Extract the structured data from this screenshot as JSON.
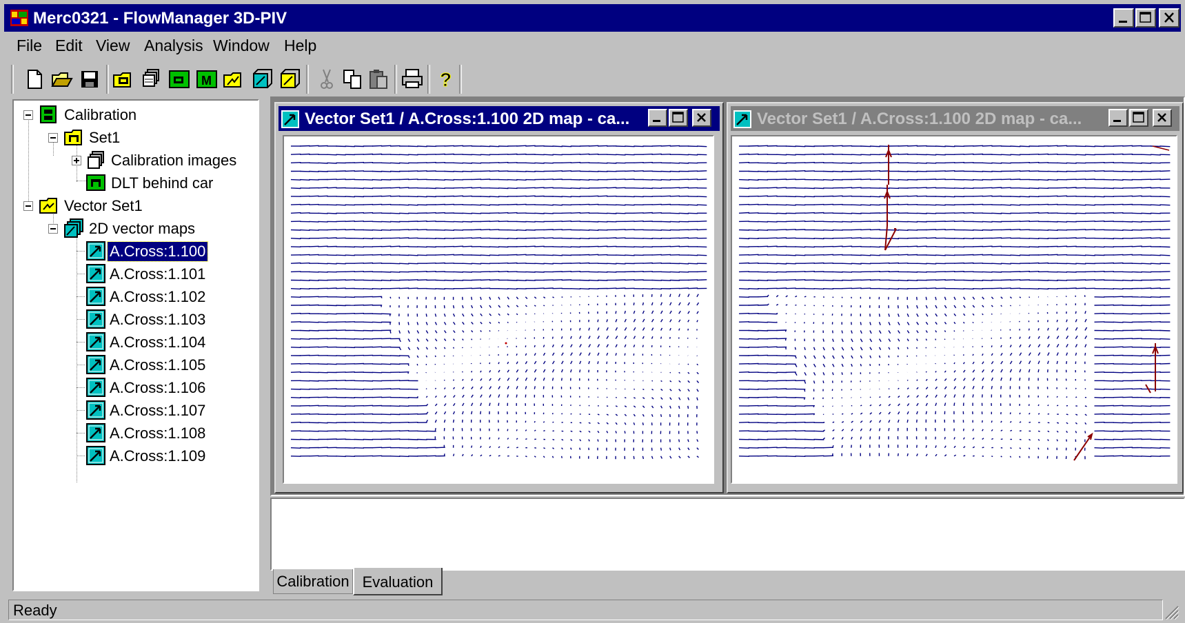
{
  "app": {
    "title": "Merc0321 - FlowManager 3D-PIV"
  },
  "menu": [
    {
      "label": "File"
    },
    {
      "label": "Edit"
    },
    {
      "label": "View"
    },
    {
      "label": "Analysis"
    },
    {
      "label": "Window"
    },
    {
      "label": "Help"
    }
  ],
  "toolbar": {
    "buttons": [
      "new-icon",
      "open-icon",
      "save-icon",
      "calibration-icon",
      "images-icon",
      "add-calib-icon",
      "mask-icon",
      "vector-icon",
      "vector-3d-icon",
      "vector-multi-icon",
      "cut-icon",
      "copy-icon",
      "paste-icon",
      "print-icon",
      "help-icon"
    ]
  },
  "tree": {
    "calibration": "Calibration",
    "set1": "Set1",
    "calibration_images": "Calibration images",
    "dlt": "DLT behind car",
    "vector_set": "Vector Set1",
    "maps_2d": "2D vector maps",
    "items": [
      "A.Cross:1.100",
      "A.Cross:1.101",
      "A.Cross:1.102",
      "A.Cross:1.103",
      "A.Cross:1.104",
      "A.Cross:1.105",
      "A.Cross:1.106",
      "A.Cross:1.107",
      "A.Cross:1.108",
      "A.Cross:1.109"
    ],
    "selected": "A.Cross:1.100"
  },
  "windows": [
    {
      "title": "Vector Set1 / A.Cross:1.100 2D map - ca...",
      "active": true
    },
    {
      "title": "Vector Set1 / A.Cross:1.100 2D map - ca...",
      "active": false
    }
  ],
  "tabs": [
    {
      "label": "Calibration"
    },
    {
      "label": "Evaluation",
      "active": true
    }
  ],
  "status": {
    "text": "Ready"
  },
  "colors": {
    "vector": "#000080",
    "outlier": "#8b0000",
    "titlebar": "#000080"
  }
}
